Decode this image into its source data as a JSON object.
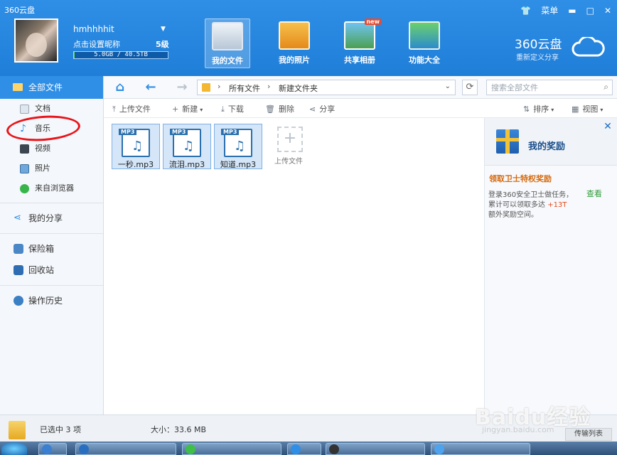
{
  "window": {
    "app_title": "360云盘",
    "menu_label": "菜单",
    "minimize": "▬",
    "maximize": "□",
    "close": "✕"
  },
  "user": {
    "username": "hmhhhhit",
    "nickname_prompt": "点击设置昵称",
    "level": "5级",
    "quota_text": "5.0GB / 40.5TB",
    "quota_fraction": 0.0001
  },
  "nav": {
    "tabs": [
      {
        "label": "我的文件",
        "active": true
      },
      {
        "label": "我的照片",
        "active": false
      },
      {
        "label": "共享相册",
        "active": false,
        "badge": "new"
      },
      {
        "label": "功能大全",
        "active": false
      }
    ]
  },
  "brand": {
    "name": "360云盘",
    "slogan": "重新定义分享"
  },
  "sidebar": {
    "all_files": "全部文件",
    "sub_items": [
      {
        "label": "文档",
        "icon": "document-icon"
      },
      {
        "label": "音乐",
        "icon": "music-note-icon"
      },
      {
        "label": "视频",
        "icon": "video-icon"
      },
      {
        "label": "照片",
        "icon": "photo-icon"
      },
      {
        "label": "来自浏览器",
        "icon": "browser-icon"
      }
    ],
    "my_share": "我的分享",
    "safe_box": "保险箱",
    "recycle_bin": "回收站",
    "history": "操作历史"
  },
  "address": {
    "crumbs": [
      "所有文件",
      "新建文件夹"
    ],
    "search_placeholder": "搜索全部文件"
  },
  "toolbar": {
    "upload": "上传文件",
    "new": "新建",
    "download": "下载",
    "delete": "删除",
    "share": "分享",
    "sort": "排序",
    "view": "视图"
  },
  "files": [
    {
      "name": "一秒.mp3",
      "type_tag": "MP3"
    },
    {
      "name": "流泪.mp3",
      "type_tag": "MP3"
    },
    {
      "name": "知道.mp3",
      "type_tag": "MP3"
    }
  ],
  "upload_tile": {
    "label": "上传文件"
  },
  "reward_panel": {
    "title": "我的奖励",
    "reward_title": "领取卫士特权奖励",
    "desc_line1": "登录360安全卫士做任务，",
    "desc_line2_prefix": "累计可以领取多达 ",
    "desc_highlight": "+13T",
    "desc_line3": "额外奖励空间。",
    "view_link": "查看"
  },
  "status": {
    "selected": "已选中 3 项",
    "size": "大小：33.6 MB",
    "transfer_list": "传输列表"
  },
  "watermark": {
    "text": "Baidu经验",
    "sub": "jingyan.baidu.com"
  },
  "colors": {
    "accent": "#2f8fe6",
    "highlight_circle": "#e8141a"
  }
}
